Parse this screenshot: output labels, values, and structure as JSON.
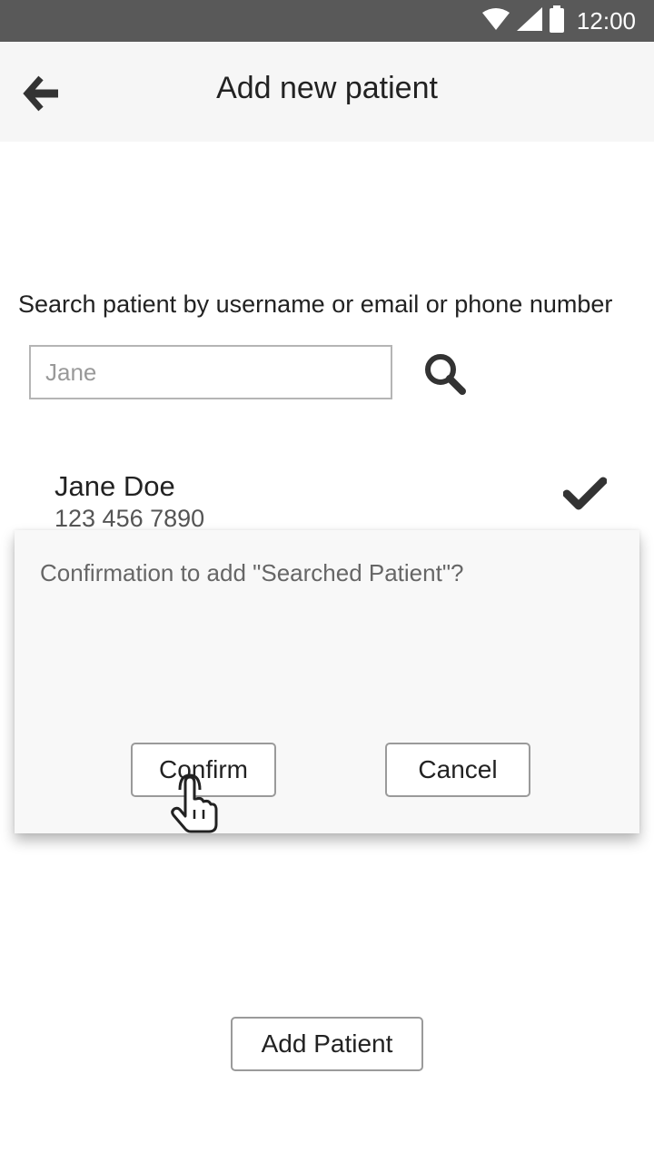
{
  "status_bar": {
    "time": "12:00",
    "icons": [
      "wifi-icon",
      "signal-icon",
      "battery-icon"
    ]
  },
  "header": {
    "title": "Add new patient",
    "back_icon": "arrow-left-icon"
  },
  "search": {
    "label": "Search patient by username or email or phone number",
    "placeholder": "Jane",
    "value": "",
    "button_icon": "search-icon"
  },
  "result": {
    "name": "Jane Doe",
    "phone": "123 456 7890",
    "selected_icon": "check-icon"
  },
  "dialog": {
    "message": "Confirmation to add \"Searched Patient\"?",
    "confirm_label": "Confirm",
    "cancel_label": "Cancel",
    "pointer_icon": "hand-pointer-icon"
  },
  "footer": {
    "add_label": "Add Patient"
  },
  "colors": {
    "status_bar": "#595959",
    "app_bar": "#f6f6f6",
    "dialog_bg": "#f8f8f8",
    "icon": "#333333"
  }
}
